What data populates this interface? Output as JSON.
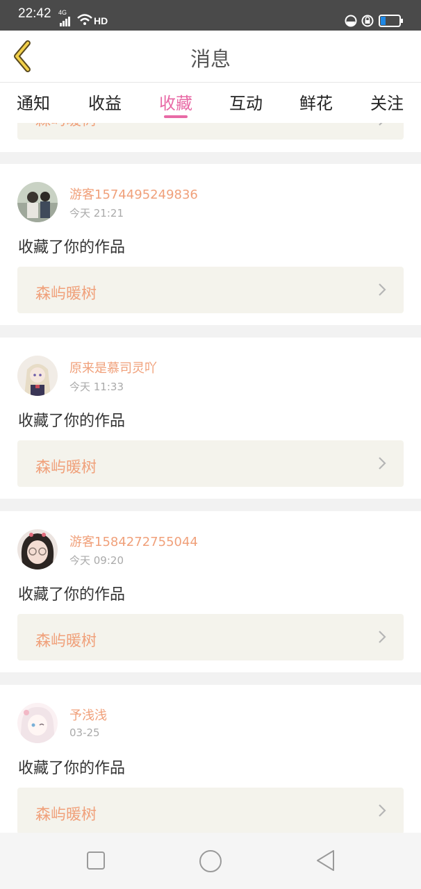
{
  "status_bar": {
    "time": "22:42",
    "network": "4G",
    "wifi_label": "HD"
  },
  "header": {
    "title": "消息"
  },
  "tabs": [
    {
      "label": "通知",
      "active": false
    },
    {
      "label": "收益",
      "active": false
    },
    {
      "label": "收藏",
      "active": true
    },
    {
      "label": "互动",
      "active": false
    },
    {
      "label": "鲜花",
      "active": false
    },
    {
      "label": "关注",
      "active": false
    }
  ],
  "accent_color": "#e86aa6",
  "name_color": "#f0a07a",
  "partial_item": {
    "work_title": "森屿暖树"
  },
  "messages": [
    {
      "user": "游客1574495249836",
      "time": "今天 21:21",
      "action": "收藏了你的作品",
      "work_title": "森屿暖树"
    },
    {
      "user": "原来是慕司灵吖",
      "time": "今天 11:33",
      "action": "收藏了你的作品",
      "work_title": "森屿暖树"
    },
    {
      "user": "游客1584272755044",
      "time": "今天 09:20",
      "action": "收藏了你的作品",
      "work_title": "森屿暖树"
    },
    {
      "user": "予浅浅",
      "time": "03-25",
      "action": "收藏了你的作品",
      "work_title": "森屿暖树"
    }
  ],
  "icons": {
    "back": "chevron-left-icon",
    "item_arrow": "chevron-right-icon",
    "nav": [
      "square-recents-icon",
      "circle-home-icon",
      "triangle-back-icon"
    ]
  }
}
